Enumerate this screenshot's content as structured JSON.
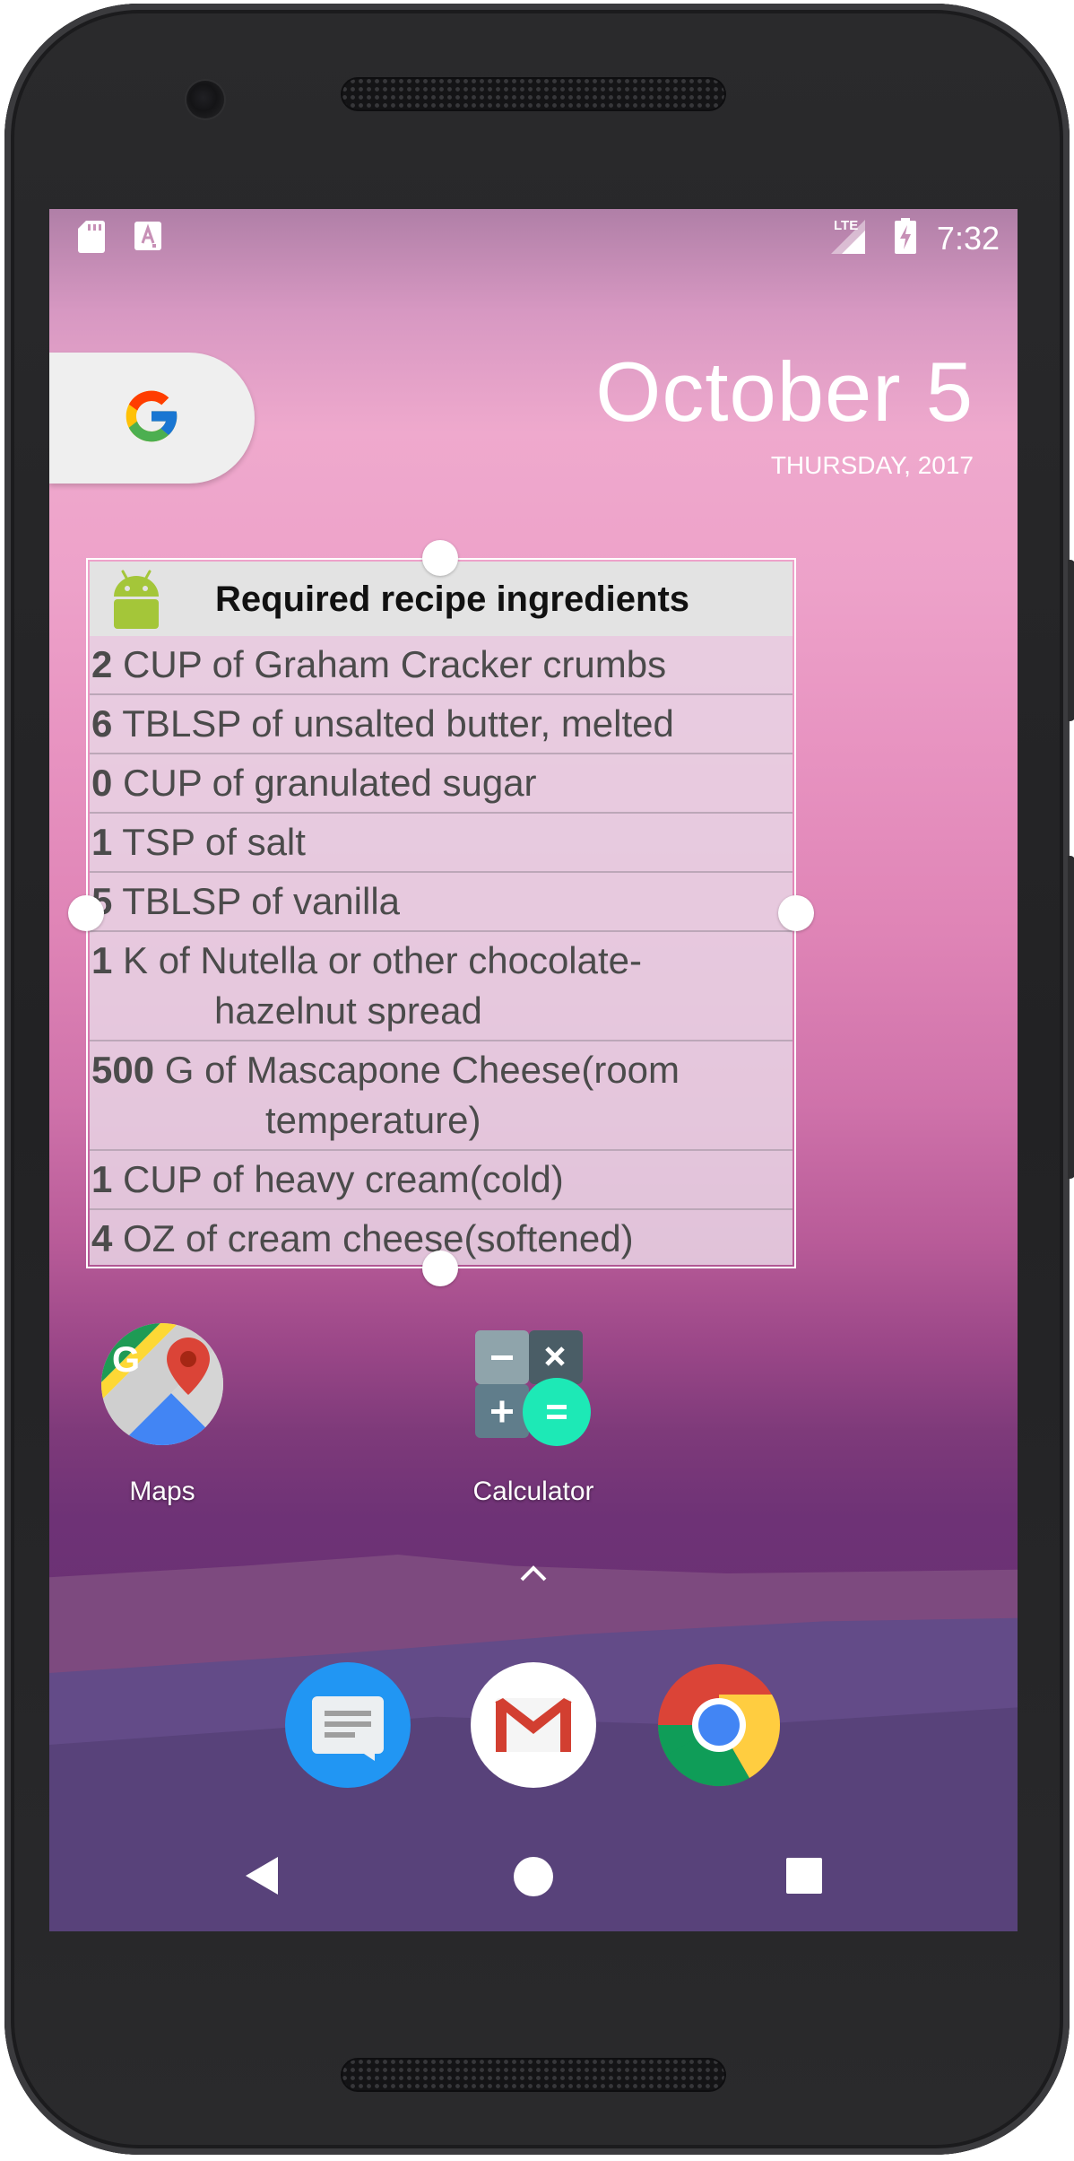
{
  "status_bar": {
    "icons": [
      "sd-card-icon",
      "text-a-icon",
      "lte-signal-icon",
      "battery-charging-icon"
    ],
    "network_label": "LTE",
    "time": "7:32"
  },
  "search_widget": {
    "icon": "google-g-icon"
  },
  "clock_widget": {
    "date": "October 5",
    "weekday_year": "THURSDAY, 2017"
  },
  "recipe_widget": {
    "title": "Required recipe ingredients",
    "icon": "android-icon",
    "ingredients": [
      {
        "qty": "2",
        "line1": "CUP of Graham Cracker crumbs",
        "line2": ""
      },
      {
        "qty": "6",
        "line1": "TBLSP of unsalted butter, melted",
        "line2": ""
      },
      {
        "qty": "0",
        "line1": "CUP of granulated sugar",
        "line2": ""
      },
      {
        "qty": "1",
        "line1": "TSP of salt",
        "line2": ""
      },
      {
        "qty": "5",
        "line1": "TBLSP of vanilla",
        "line2": ""
      },
      {
        "qty": "1",
        "line1": "K of Nutella or other chocolate-",
        "line2": "hazelnut spread"
      },
      {
        "qty": "500",
        "line1": "G of Mascapone Cheese(room",
        "line2": "temperature)"
      },
      {
        "qty": "1",
        "line1": "CUP of heavy cream(cold)",
        "line2": ""
      },
      {
        "qty": "4",
        "line1": "OZ of cream cheese(softened)",
        "line2": ""
      }
    ]
  },
  "home_apps": [
    {
      "label": "Maps",
      "icon": "maps-icon"
    },
    {
      "label": "Calculator",
      "icon": "calculator-icon"
    }
  ],
  "dock": [
    {
      "name": "Messages",
      "icon": "messages-icon",
      "color": "#2196f3"
    },
    {
      "name": "Gmail",
      "icon": "gmail-icon",
      "color": "#ffffff"
    },
    {
      "name": "Chrome",
      "icon": "chrome-icon",
      "color": "#4285f4"
    }
  ],
  "nav_bar": [
    "back-icon",
    "home-icon",
    "recents-icon"
  ],
  "colors": {
    "widget_bg": "#e8d4e4",
    "wallpaper_top": "#efa9cd",
    "wallpaper_bottom": "#5f2d6b",
    "accent_teal": "#1de9b6"
  }
}
